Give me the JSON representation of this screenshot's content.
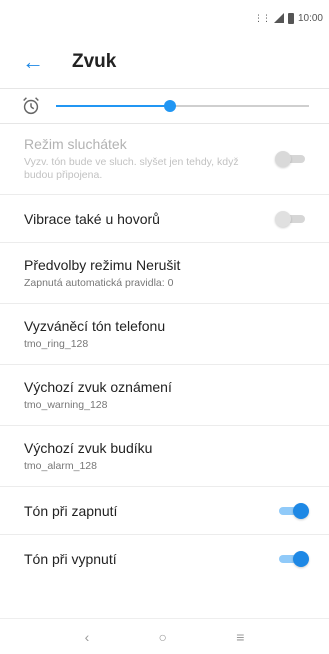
{
  "status_bar": {
    "time": "10:00"
  },
  "app_bar": {
    "back_icon": "arrow-left-icon",
    "title": "Zvuk"
  },
  "alarm_volume": {
    "icon": "alarm-icon",
    "level": 0.45
  },
  "rows": [
    {
      "label": "Režim sluchátek",
      "sub": "Vyzv. tón bude ve sluch. slyšet jen tehdy, když budou připojena.",
      "toggle": "off-disabled"
    },
    {
      "label": "Vibrace také u hovorů",
      "toggle": "off"
    },
    {
      "label": "Předvolby režimu Nerušit",
      "sub": "Zapnutá automatická pravidla: 0"
    },
    {
      "label": "Vyzváněcí tón telefonu",
      "sub": "tmo_ring_128"
    },
    {
      "label": "Výchozí zvuk oznámení",
      "sub": "tmo_warning_128"
    },
    {
      "label": "Výchozí zvuk budíku",
      "sub": "tmo_alarm_128"
    },
    {
      "label": "Tón při zapnutí",
      "toggle": "on"
    },
    {
      "label": "Tón při vypnutí",
      "toggle": "on"
    }
  ],
  "nav_bar": {
    "back_icon": "back-chevron-icon",
    "home_icon": "home-circle-icon",
    "menu_icon": "menu-lines-icon"
  },
  "colors": {
    "accent": "#1e88e5",
    "disabled_text": "#b3b3b3"
  }
}
